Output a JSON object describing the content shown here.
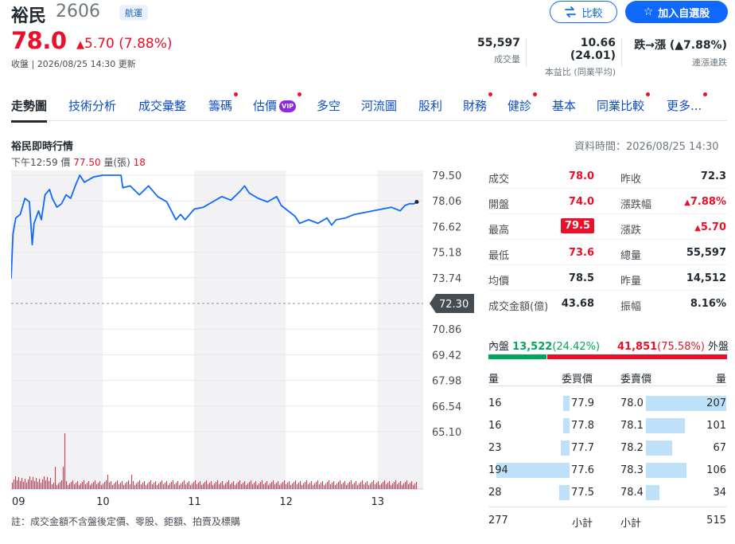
{
  "header": {
    "name": "裕民",
    "code": "2606",
    "sector": "航運",
    "price": "78.0",
    "change": "5.70 (7.88%)",
    "close_time": "收盤 | 2026/08/25 14:30 更新",
    "compare_label": "比較",
    "watchlist_label": "加入自選股"
  },
  "stats": [
    {
      "value": "55,597",
      "label": "成交量"
    },
    {
      "value": "10.66 (24.01)",
      "label": "本益比 (同業平均)"
    },
    {
      "value": "跌→漲 (▲7.88%)",
      "label": "連漲連跌"
    }
  ],
  "tabs": [
    {
      "label": "走勢圖"
    },
    {
      "label": "技術分析"
    },
    {
      "label": "成交彙整"
    },
    {
      "label": "籌碼"
    },
    {
      "label": "估價"
    },
    {
      "label": "多空"
    },
    {
      "label": "河流圖"
    },
    {
      "label": "股利"
    },
    {
      "label": "財務"
    },
    {
      "label": "健診"
    },
    {
      "label": "基本"
    },
    {
      "label": "同業比較"
    },
    {
      "label": "更多..."
    }
  ],
  "vip_label": "VIP",
  "section": {
    "title": "裕民即時行情",
    "data_time": "資料時間：2026/08/25 14:30",
    "info_time": "下午12:59",
    "info_price_label": "價",
    "info_price": "77.50",
    "info_vol_label": "量(張)",
    "info_vol": "18",
    "note": "註：成交金額不含盤後定價、零股、鉅額、拍賣及標購"
  },
  "chart_data": {
    "type": "line",
    "x_ticks": [
      "09",
      "10",
      "11",
      "12",
      "13"
    ],
    "y_ticks": [
      "79.50",
      "78.06",
      "76.62",
      "75.18",
      "73.74",
      "70.86",
      "69.42",
      "67.98",
      "66.54",
      "65.10"
    ],
    "ylim": [
      65.1,
      79.5
    ],
    "prev_close": "72.30",
    "series": [
      {
        "values": [
          [
            9.0,
            73.7
          ],
          [
            9.02,
            76.2
          ],
          [
            9.05,
            77.1
          ],
          [
            9.1,
            77.3
          ],
          [
            9.15,
            78.2
          ],
          [
            9.2,
            78.0
          ],
          [
            9.23,
            75.6
          ],
          [
            9.25,
            76.8
          ],
          [
            9.3,
            77.5
          ],
          [
            9.33,
            77.0
          ],
          [
            9.37,
            78.4
          ],
          [
            9.42,
            78.7
          ],
          [
            9.45,
            78.2
          ],
          [
            9.5,
            77.7
          ],
          [
            9.55,
            77.9
          ],
          [
            9.6,
            78.4
          ],
          [
            9.65,
            78.2
          ],
          [
            9.7,
            78.9
          ],
          [
            9.75,
            79.5
          ],
          [
            9.8,
            79.1
          ],
          [
            9.9,
            79.4
          ],
          [
            10.0,
            79.5
          ],
          [
            10.1,
            79.5
          ],
          [
            10.2,
            79.5
          ],
          [
            10.22,
            78.8
          ],
          [
            10.3,
            78.9
          ],
          [
            10.4,
            78.4
          ],
          [
            10.5,
            78.9
          ],
          [
            10.6,
            78.3
          ],
          [
            10.7,
            78.0
          ],
          [
            10.75,
            77.5
          ],
          [
            10.8,
            77.0
          ],
          [
            10.85,
            77.3
          ],
          [
            10.9,
            77.0
          ],
          [
            11.0,
            77.6
          ],
          [
            11.1,
            77.7
          ],
          [
            11.2,
            78.0
          ],
          [
            11.3,
            78.3
          ],
          [
            11.4,
            78.1
          ],
          [
            11.5,
            78.6
          ],
          [
            11.55,
            78.9
          ],
          [
            11.6,
            78.5
          ],
          [
            11.7,
            78.2
          ],
          [
            11.8,
            78.0
          ],
          [
            11.9,
            78.3
          ],
          [
            11.95,
            77.8
          ],
          [
            12.0,
            77.6
          ],
          [
            12.1,
            77.2
          ],
          [
            12.15,
            76.8
          ],
          [
            12.25,
            77.0
          ],
          [
            12.35,
            76.8
          ],
          [
            12.45,
            77.1
          ],
          [
            12.5,
            76.7
          ],
          [
            12.55,
            77.0
          ],
          [
            12.65,
            77.1
          ],
          [
            12.75,
            77.3
          ],
          [
            12.85,
            77.4
          ],
          [
            12.95,
            77.5
          ],
          [
            13.05,
            77.6
          ],
          [
            13.15,
            77.7
          ],
          [
            13.25,
            77.5
          ],
          [
            13.3,
            77.8
          ],
          [
            13.35,
            77.9
          ],
          [
            13.4,
            77.9
          ],
          [
            13.43,
            78.0
          ]
        ]
      }
    ]
  },
  "quote": {
    "left": [
      {
        "label": "成交",
        "value": "78.0"
      },
      {
        "label": "開盤",
        "value": "74.0"
      },
      {
        "label": "最高",
        "value": "79.5"
      },
      {
        "label": "最低",
        "value": "73.6"
      },
      {
        "label": "均價",
        "value": "78.5"
      },
      {
        "label": "成交金額(億)",
        "value": "43.68"
      }
    ],
    "right": [
      {
        "label": "昨收",
        "value": "72.3"
      },
      {
        "label": "漲跌幅",
        "value": "7.88%"
      },
      {
        "label": "漲跌",
        "value": "5.70"
      },
      {
        "label": "總量",
        "value": "55,597"
      },
      {
        "label": "昨量",
        "value": "14,512"
      },
      {
        "label": "振幅",
        "value": "8.16%"
      }
    ]
  },
  "orderbook": {
    "inner_label": "內盤",
    "inner_value": "13,522",
    "inner_pct": "(24.42%)",
    "inner_ratio": 0.2442,
    "outer_value": "41,851",
    "outer_pct": "(75.58%)",
    "outer_label": "外盤",
    "headers": [
      "量",
      "委買價",
      "委賣價",
      "量"
    ],
    "bids": [
      {
        "vol": "16",
        "price": "77.9",
        "size": 16
      },
      {
        "vol": "16",
        "price": "77.8",
        "size": 16
      },
      {
        "vol": "23",
        "price": "77.7",
        "size": 23
      },
      {
        "vol": "194",
        "price": "77.6",
        "size": 194
      },
      {
        "vol": "28",
        "price": "77.5",
        "size": 28
      }
    ],
    "asks": [
      {
        "price": "78.0",
        "vol": "207",
        "size": 207
      },
      {
        "price": "78.1",
        "vol": "101",
        "size": 101
      },
      {
        "price": "78.2",
        "vol": "67",
        "size": 67
      },
      {
        "price": "78.3",
        "vol": "106",
        "size": 106
      },
      {
        "price": "78.4",
        "vol": "34",
        "size": 34
      }
    ],
    "bid_total": "277",
    "bid_total_label": "小計",
    "ask_total_label": "小計",
    "ask_total": "515"
  }
}
